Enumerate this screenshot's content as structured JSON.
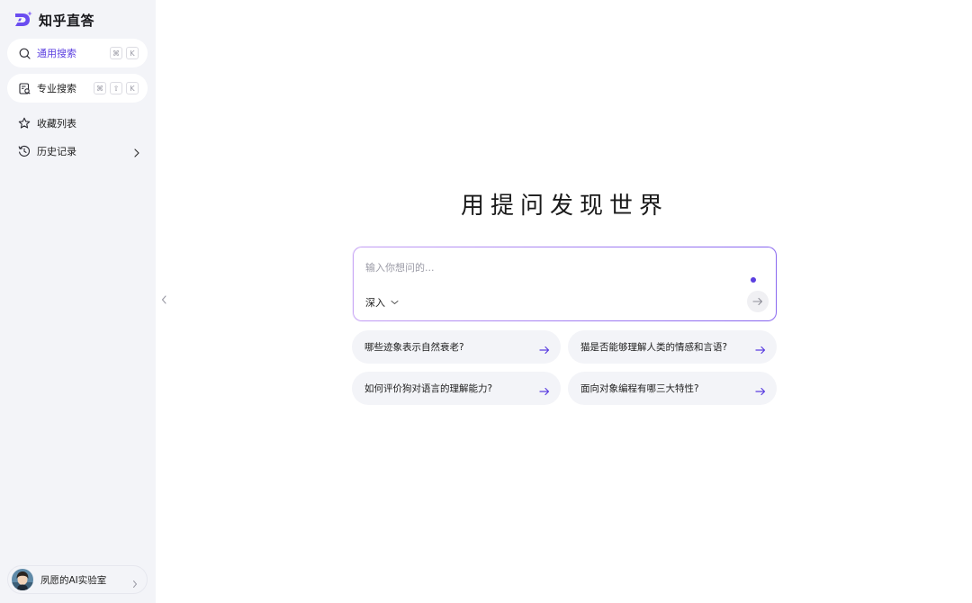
{
  "brand": {
    "name": "知乎直答"
  },
  "sidebar": {
    "general_search": {
      "label": "通用搜索",
      "keys": [
        "⌘",
        "K"
      ]
    },
    "pro_search": {
      "label": "专业搜索",
      "keys": [
        "⌘",
        "⇧",
        "K"
      ]
    },
    "favorites": {
      "label": "收藏列表"
    },
    "history": {
      "label": "历史记录"
    }
  },
  "user": {
    "name": "夙愿的AI实验室"
  },
  "main": {
    "title": "用提问发现世界",
    "input": {
      "placeholder": "输入你想问的...",
      "value": ""
    },
    "mode": {
      "selected": "深入"
    },
    "suggestions": [
      "哪些迹象表示自然衰老?",
      "猫是否能够理解人类的情感和言语?",
      "如何评价狗对语言的理解能力?",
      "面向对象编程有哪三大特性?"
    ]
  },
  "colors": {
    "accent": "#5b3fe0",
    "sidebar_bg": "#f3f4f8"
  }
}
